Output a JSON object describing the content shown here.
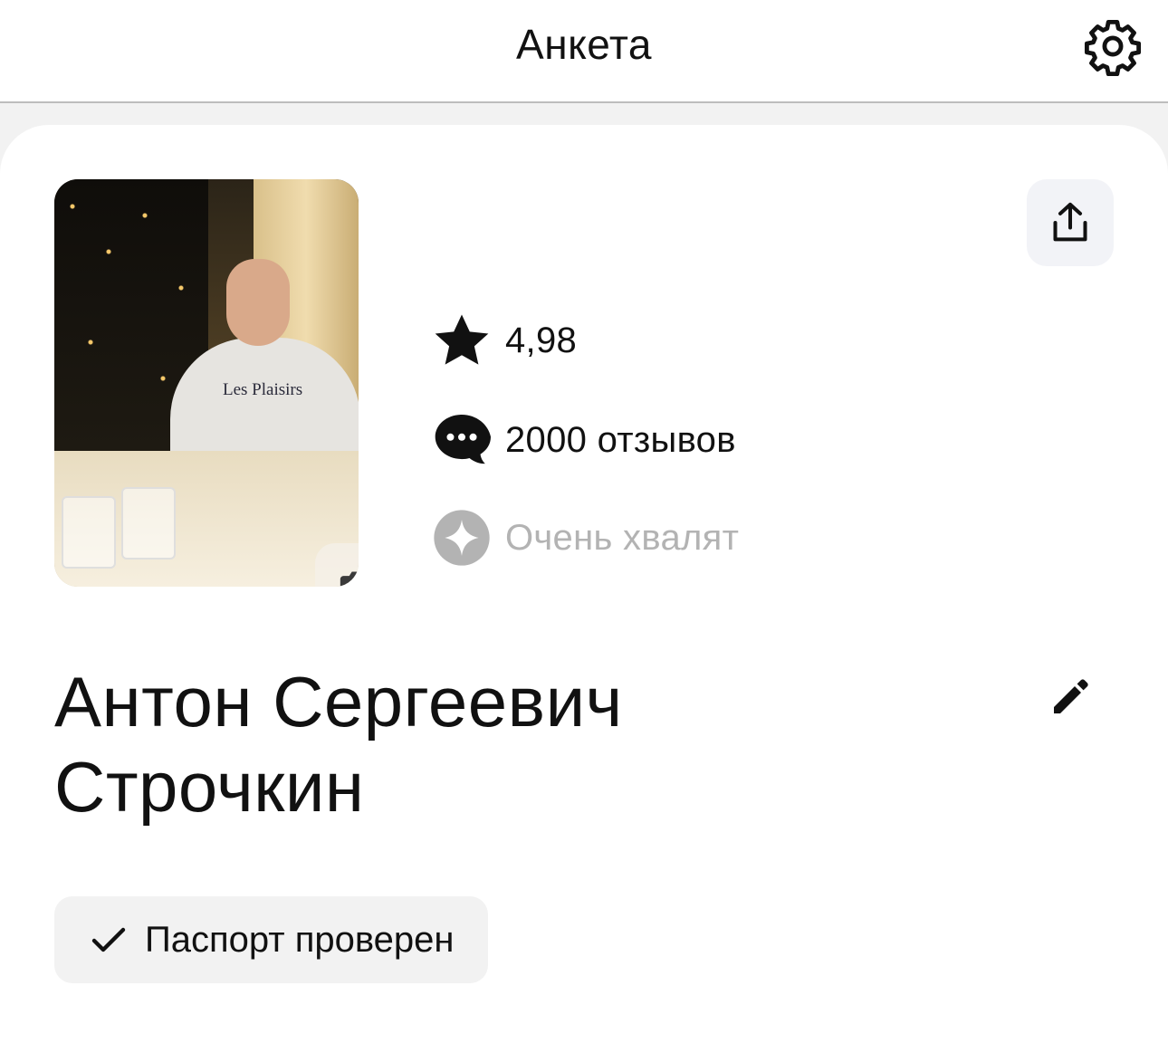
{
  "header": {
    "title": "Анкета",
    "settings_icon": "gear-icon"
  },
  "profile": {
    "photo_alt": "Фото профиля",
    "photo_shirt_text": "Les Plaisirs",
    "camera_icon": "camera-icon",
    "share_icon": "share-upload-icon",
    "rating": "4,98",
    "reviews": "2000 отзывов",
    "praise": "Очень хвалят",
    "name_line1": "Антон Сергеевич",
    "name_line2": "Строчкин",
    "edit_icon": "pencil-icon",
    "verified_label": "Паспорт проверен"
  },
  "colors": {
    "background": "#f2f2f2",
    "card": "#ffffff",
    "text": "#111111",
    "muted": "#b3b3b3",
    "share_button_bg": "#f2f3f7"
  }
}
